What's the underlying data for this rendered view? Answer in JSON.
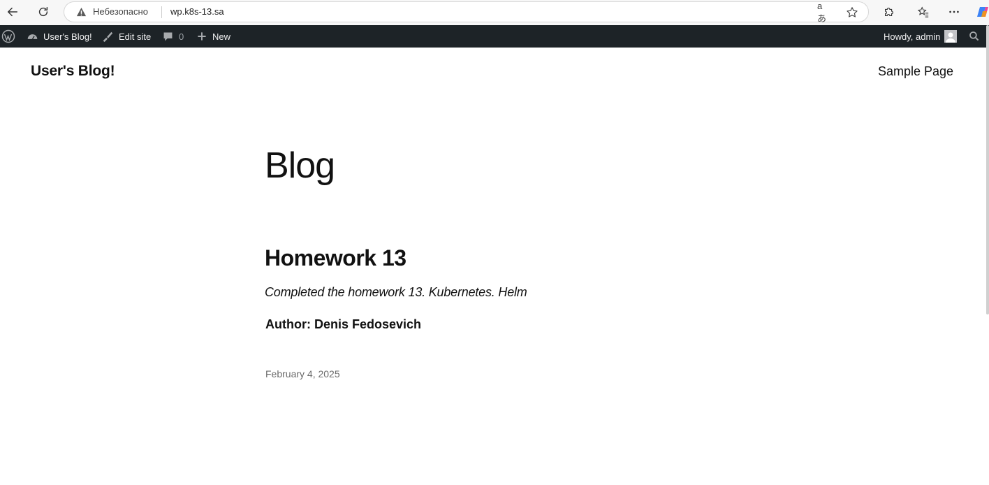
{
  "browser": {
    "insecure_label": "Небезопасно",
    "url": "wp.k8s-13.sa"
  },
  "admin_bar": {
    "site_name": "User's Blog!",
    "edit_site": "Edit site",
    "comments_count": "0",
    "new_label": "New",
    "howdy": "Howdy, admin"
  },
  "site": {
    "title": "User's Blog!",
    "nav": [
      "Sample Page"
    ]
  },
  "page": {
    "title": "Blog"
  },
  "post": {
    "title": "Homework 13",
    "excerpt": "Completed the homework 13. Kubernetes. Helm",
    "author": "Author: Denis Fedosevich",
    "date": "February 4, 2025"
  }
}
